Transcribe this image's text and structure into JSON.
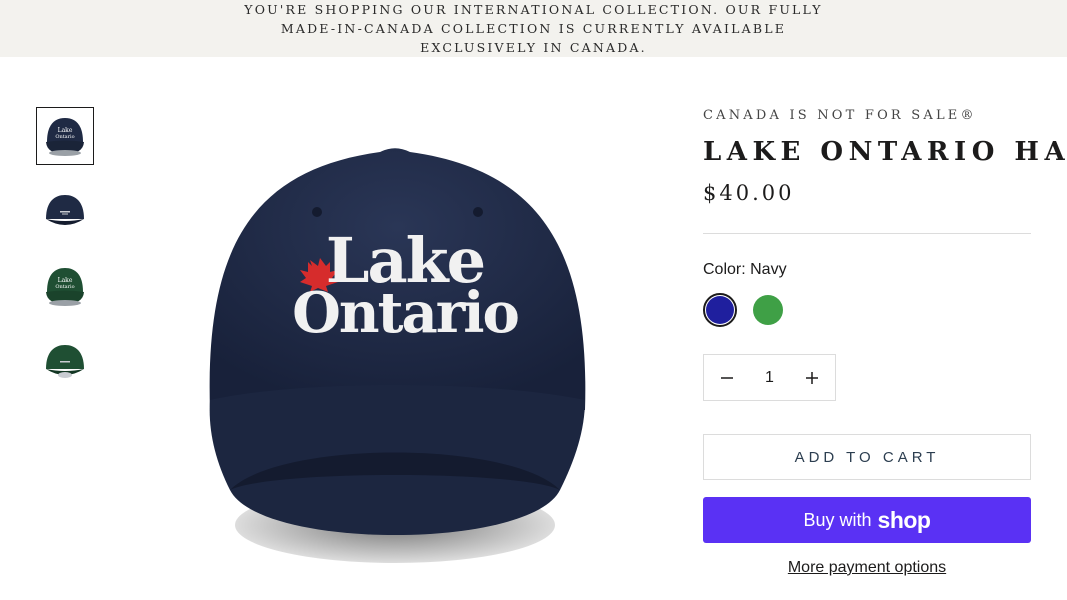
{
  "banner": {
    "text": "You're shopping our international collection. Our fully made-in-Canada collection is currently available exclusively in Canada."
  },
  "gallery": {
    "thumbnails": [
      {
        "name": "Navy front",
        "color": "#1f2a44"
      },
      {
        "name": "Navy back",
        "color": "#1f2a44"
      },
      {
        "name": "Green front",
        "color": "#1f4f33"
      },
      {
        "name": "Green back",
        "color": "#1f4f33"
      }
    ],
    "main_hat": {
      "line1": "Lake",
      "line2": "Ontario",
      "cap_color": "#1f2a44",
      "leaf_color": "#d62c2c"
    }
  },
  "product": {
    "vendor": "Canada is not for sale®",
    "title": "Lake Ontario Hat",
    "price": "$40.00",
    "color_label": "Color: Navy",
    "swatches": [
      {
        "name": "Navy",
        "color": "#1f1f9e",
        "selected": true
      },
      {
        "name": "Green",
        "color": "#3fa046",
        "selected": false
      }
    ],
    "quantity": "1",
    "add_to_cart": "Add to cart",
    "buy_with": "Buy with",
    "shop_brand": "shop",
    "more_payment": "More payment options"
  },
  "colors": {
    "shop_pay": "#5a31f4",
    "banner_bg": "#f3f2ee"
  }
}
